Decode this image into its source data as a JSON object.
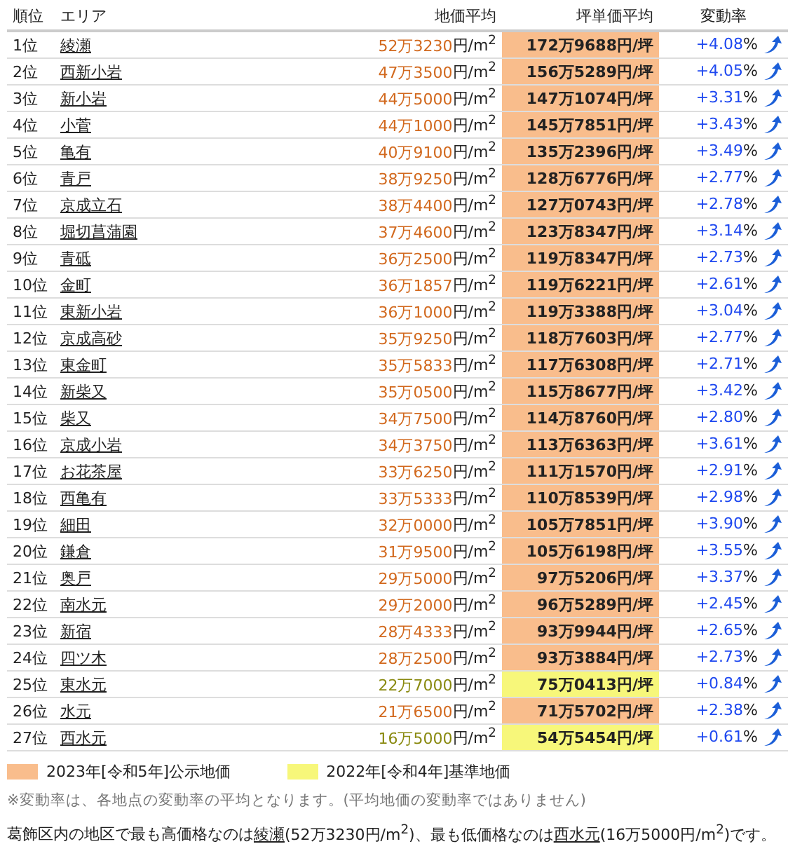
{
  "table": {
    "columns": [
      "順位",
      "エリア",
      "地価平均",
      "坪単価平均",
      "変動率"
    ],
    "rows": [
      {
        "rank": "1位",
        "area": "綾瀬",
        "price": "52万3230",
        "price_unit": "円/m$^{2}$",
        "tsubo": "172万9688",
        "tsubo_unit": "円/坪",
        "rate": "+4.08",
        "rate_unit": "%",
        "kind": "koji"
      },
      {
        "rank": "2位",
        "area": "西新小岩",
        "price": "47万3500",
        "price_unit": "円/m$^{2}$",
        "tsubo": "156万5289",
        "tsubo_unit": "円/坪",
        "rate": "+4.05",
        "rate_unit": "%",
        "kind": "koji"
      },
      {
        "rank": "3位",
        "area": "新小岩",
        "price": "44万5000",
        "price_unit": "円/m$^{2}$",
        "tsubo": "147万1074",
        "tsubo_unit": "円/坪",
        "rate": "+3.31",
        "rate_unit": "%",
        "kind": "koji"
      },
      {
        "rank": "4位",
        "area": "小菅",
        "price": "44万1000",
        "price_unit": "円/m$^{2}$",
        "tsubo": "145万7851",
        "tsubo_unit": "円/坪",
        "rate": "+3.43",
        "rate_unit": "%",
        "kind": "koji"
      },
      {
        "rank": "5位",
        "area": "亀有",
        "price": "40万9100",
        "price_unit": "円/m$^{2}$",
        "tsubo": "135万2396",
        "tsubo_unit": "円/坪",
        "rate": "+3.49",
        "rate_unit": "%",
        "kind": "koji"
      },
      {
        "rank": "6位",
        "area": "青戸",
        "price": "38万9250",
        "price_unit": "円/m$^{2}$",
        "tsubo": "128万6776",
        "tsubo_unit": "円/坪",
        "rate": "+2.77",
        "rate_unit": "%",
        "kind": "koji"
      },
      {
        "rank": "7位",
        "area": "京成立石",
        "price": "38万4400",
        "price_unit": "円/m$^{2}$",
        "tsubo": "127万0743",
        "tsubo_unit": "円/坪",
        "rate": "+2.78",
        "rate_unit": "%",
        "kind": "koji"
      },
      {
        "rank": "8位",
        "area": "堀切菖蒲園",
        "price": "37万4600",
        "price_unit": "円/m$^{2}$",
        "tsubo": "123万8347",
        "tsubo_unit": "円/坪",
        "rate": "+3.14",
        "rate_unit": "%",
        "kind": "koji"
      },
      {
        "rank": "9位",
        "area": "青砥",
        "price": "36万2500",
        "price_unit": "円/m$^{2}$",
        "tsubo": "119万8347",
        "tsubo_unit": "円/坪",
        "rate": "+2.73",
        "rate_unit": "%",
        "kind": "koji"
      },
      {
        "rank": "10位",
        "area": "金町",
        "price": "36万1857",
        "price_unit": "円/m$^{2}$",
        "tsubo": "119万6221",
        "tsubo_unit": "円/坪",
        "rate": "+2.61",
        "rate_unit": "%",
        "kind": "koji"
      },
      {
        "rank": "11位",
        "area": "東新小岩",
        "price": "36万1000",
        "price_unit": "円/m$^{2}$",
        "tsubo": "119万3388",
        "tsubo_unit": "円/坪",
        "rate": "+3.04",
        "rate_unit": "%",
        "kind": "koji"
      },
      {
        "rank": "12位",
        "area": "京成高砂",
        "price": "35万9250",
        "price_unit": "円/m$^{2}$",
        "tsubo": "118万7603",
        "tsubo_unit": "円/坪",
        "rate": "+2.77",
        "rate_unit": "%",
        "kind": "koji"
      },
      {
        "rank": "13位",
        "area": "東金町",
        "price": "35万5833",
        "price_unit": "円/m$^{2}$",
        "tsubo": "117万6308",
        "tsubo_unit": "円/坪",
        "rate": "+2.71",
        "rate_unit": "%",
        "kind": "koji"
      },
      {
        "rank": "14位",
        "area": "新柴又",
        "price": "35万0500",
        "price_unit": "円/m$^{2}$",
        "tsubo": "115万8677",
        "tsubo_unit": "円/坪",
        "rate": "+3.42",
        "rate_unit": "%",
        "kind": "koji"
      },
      {
        "rank": "15位",
        "area": "柴又",
        "price": "34万7500",
        "price_unit": "円/m$^{2}$",
        "tsubo": "114万8760",
        "tsubo_unit": "円/坪",
        "rate": "+2.80",
        "rate_unit": "%",
        "kind": "koji"
      },
      {
        "rank": "16位",
        "area": "京成小岩",
        "price": "34万3750",
        "price_unit": "円/m$^{2}$",
        "tsubo": "113万6363",
        "tsubo_unit": "円/坪",
        "rate": "+3.61",
        "rate_unit": "%",
        "kind": "koji"
      },
      {
        "rank": "17位",
        "area": "お花茶屋",
        "price": "33万6250",
        "price_unit": "円/m$^{2}$",
        "tsubo": "111万1570",
        "tsubo_unit": "円/坪",
        "rate": "+2.91",
        "rate_unit": "%",
        "kind": "koji"
      },
      {
        "rank": "18位",
        "area": "西亀有",
        "price": "33万5333",
        "price_unit": "円/m$^{2}$",
        "tsubo": "110万8539",
        "tsubo_unit": "円/坪",
        "rate": "+2.98",
        "rate_unit": "%",
        "kind": "koji"
      },
      {
        "rank": "19位",
        "area": "細田",
        "price": "32万0000",
        "price_unit": "円/m$^{2}$",
        "tsubo": "105万7851",
        "tsubo_unit": "円/坪",
        "rate": "+3.90",
        "rate_unit": "%",
        "kind": "koji"
      },
      {
        "rank": "20位",
        "area": "鎌倉",
        "price": "31万9500",
        "price_unit": "円/m$^{2}$",
        "tsubo": "105万6198",
        "tsubo_unit": "円/坪",
        "rate": "+3.55",
        "rate_unit": "%",
        "kind": "koji"
      },
      {
        "rank": "21位",
        "area": "奥戸",
        "price": "29万5000",
        "price_unit": "円/m$^{2}$",
        "tsubo": "97万5206",
        "tsubo_unit": "円/坪",
        "rate": "+3.37",
        "rate_unit": "%",
        "kind": "koji"
      },
      {
        "rank": "22位",
        "area": "南水元",
        "price": "29万2000",
        "price_unit": "円/m$^{2}$",
        "tsubo": "96万5289",
        "tsubo_unit": "円/坪",
        "rate": "+2.45",
        "rate_unit": "%",
        "kind": "koji"
      },
      {
        "rank": "23位",
        "area": "新宿",
        "price": "28万4333",
        "price_unit": "円/m$^{2}$",
        "tsubo": "93万9944",
        "tsubo_unit": "円/坪",
        "rate": "+2.65",
        "rate_unit": "%",
        "kind": "koji"
      },
      {
        "rank": "24位",
        "area": "四ツ木",
        "price": "28万2500",
        "price_unit": "円/m$^{2}$",
        "tsubo": "93万3884",
        "tsubo_unit": "円/坪",
        "rate": "+2.73",
        "rate_unit": "%",
        "kind": "koji"
      },
      {
        "rank": "25位",
        "area": "東水元",
        "price": "22万7000",
        "price_unit": "円/m$^{2}$",
        "tsubo": "75万0413",
        "tsubo_unit": "円/坪",
        "rate": "+0.84",
        "rate_unit": "%",
        "kind": "kijun"
      },
      {
        "rank": "26位",
        "area": "水元",
        "price": "21万6500",
        "price_unit": "円/m$^{2}$",
        "tsubo": "71万5702",
        "tsubo_unit": "円/坪",
        "rate": "+2.38",
        "rate_unit": "%",
        "kind": "koji"
      },
      {
        "rank": "27位",
        "area": "西水元",
        "price": "16万5000",
        "price_unit": "円/m$^{2}$",
        "tsubo": "54万5454",
        "tsubo_unit": "円/坪",
        "rate": "+0.61",
        "rate_unit": "%",
        "kind": "kijun"
      }
    ]
  },
  "legend": [
    {
      "label": "2023年[令和5年]公示地価",
      "color": "#f9bd8c"
    },
    {
      "label": "2022年[令和4年]基準地価",
      "color": "#f7f77a"
    }
  ],
  "note": "※変動率は、各地点の変動率の平均となります。(平均地価の変動率ではありません)",
  "summary": [
    {
      "kind": "text",
      "text": "葛飾区内の地区で最も高価格なのは"
    },
    {
      "kind": "link",
      "text": "綾瀬"
    },
    {
      "kind": "text",
      "text": "(52万3230円/m$^{2}$)、最も低価格なのは"
    },
    {
      "kind": "link",
      "text": "西水元"
    },
    {
      "kind": "text",
      "text": "(16万5000円/m$^{2}$)です。"
    }
  ]
}
